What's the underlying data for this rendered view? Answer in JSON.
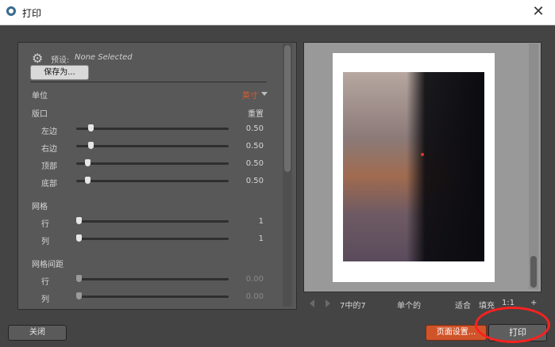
{
  "window": {
    "title": "打印",
    "close_label": "✕"
  },
  "preset": {
    "label": "预设:",
    "value": "None Selected",
    "save_as_label": "保存为..."
  },
  "units": {
    "label": "单位",
    "value": "英寸"
  },
  "margins": {
    "label": "版口",
    "reset_label": "重置",
    "rows": [
      {
        "label": "左边",
        "value": "0.50",
        "fraction": 0.08
      },
      {
        "label": "右边",
        "value": "0.50",
        "fraction": 0.08
      },
      {
        "label": "顶部",
        "value": "0.50",
        "fraction": 0.06
      },
      {
        "label": "底部",
        "value": "0.50",
        "fraction": 0.06
      }
    ]
  },
  "grid": {
    "label": "网格",
    "rows": [
      {
        "label": "行",
        "value": "1",
        "fraction": 0.0
      },
      {
        "label": "列",
        "value": "1",
        "fraction": 0.0
      }
    ]
  },
  "grid_spacing": {
    "label": "网格间距",
    "rows": [
      {
        "label": "行",
        "value": "0.00",
        "fraction": 0.0
      },
      {
        "label": "列",
        "value": "0.00",
        "fraction": 0.0
      }
    ]
  },
  "preview_nav": {
    "page_indicator": "7中的7",
    "single_label": "单个的",
    "fit_label": "适合",
    "fill_label": "填充",
    "ratio_label": "1:1",
    "plus_label": "+"
  },
  "footer": {
    "close_label": "关闭",
    "page_setup_label": "页面设置...",
    "print_label": "打印"
  },
  "colors": {
    "accent": "#d0542a",
    "highlight": "#ff2020"
  }
}
